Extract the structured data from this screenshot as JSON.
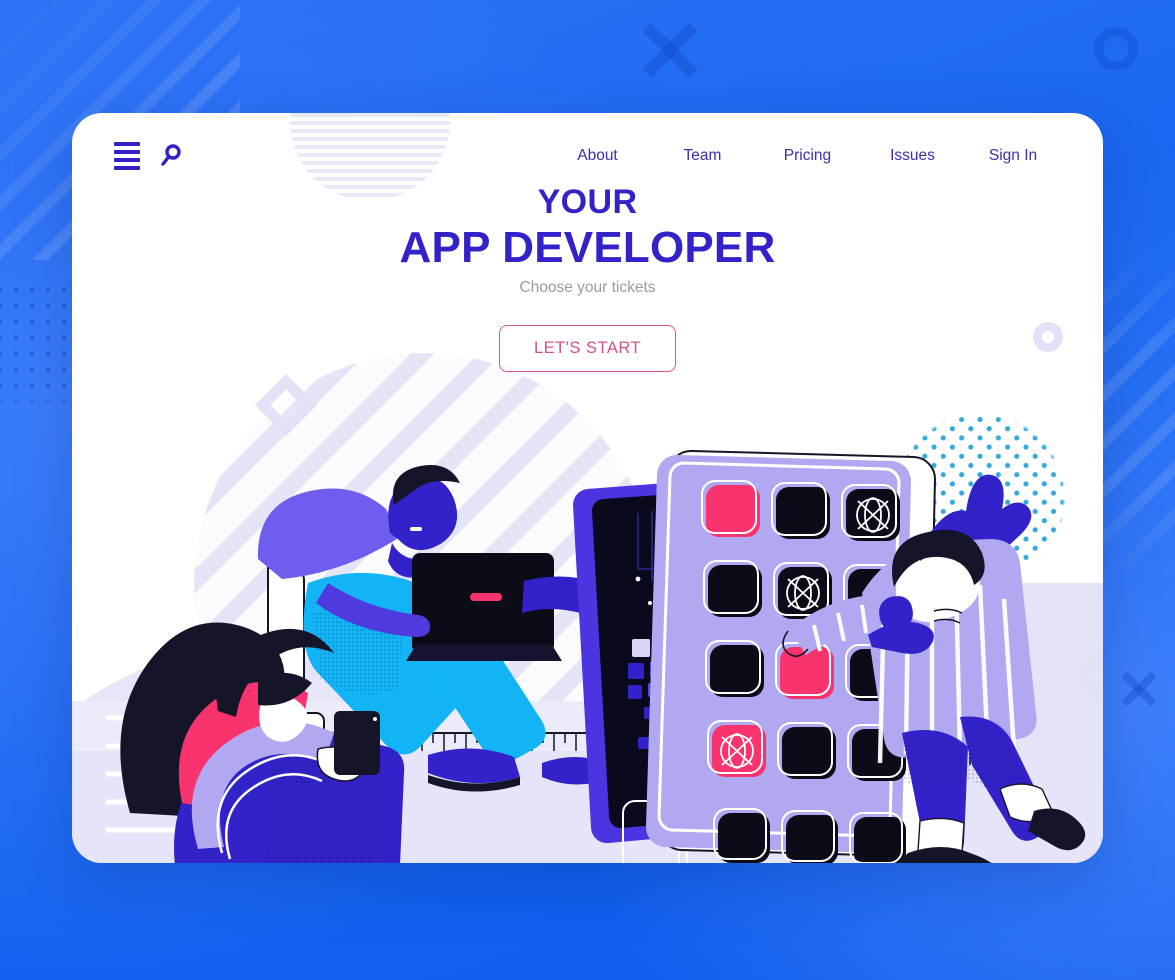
{
  "page": {
    "background_color": "#1464f0",
    "card_background": "#ffffff"
  },
  "header": {
    "menu_icon": "hamburger-icon",
    "search_icon": "search-icon",
    "nav": [
      {
        "label": "About"
      },
      {
        "label": "Team"
      },
      {
        "label": "Pricing"
      },
      {
        "label": "Issues"
      },
      {
        "label": "Sign In"
      }
    ]
  },
  "hero": {
    "eyebrow": "YOUR",
    "title": "APP DEVELOPER",
    "subtitle": "Choose your tickets",
    "cta_label": "LET'S START",
    "title_color": "#3322c9",
    "subtitle_color": "#9a9aa8",
    "cta_color": "#d8507f"
  },
  "illustration": {
    "name": "app-developer-illustration",
    "phone_back": {
      "name": "dark-circuit-phone",
      "screen_color": "#0a0a1e",
      "body_color": "#4a35e0"
    },
    "phone_front": {
      "name": "app-grid-phone",
      "body_color": "#b0a8f0",
      "app_tiles": [
        {
          "row": 1,
          "col": 1,
          "color": "#f9336e",
          "glyph": "none"
        },
        {
          "row": 1,
          "col": 2,
          "color": "#0c0c18",
          "glyph": "none"
        },
        {
          "row": 1,
          "col": 3,
          "color": "#0c0c18",
          "glyph": "target"
        },
        {
          "row": 2,
          "col": 1,
          "color": "#0c0c18",
          "glyph": "none"
        },
        {
          "row": 2,
          "col": 2,
          "color": "#0c0c18",
          "glyph": "target"
        },
        {
          "row": 2,
          "col": 3,
          "color": "#0c0c18",
          "glyph": "none"
        },
        {
          "row": 3,
          "col": 1,
          "color": "#0c0c18",
          "glyph": "none"
        },
        {
          "row": 3,
          "col": 2,
          "color": "#f9336e",
          "glyph": "none"
        },
        {
          "row": 3,
          "col": 3,
          "color": "#0c0c18",
          "glyph": "none"
        },
        {
          "row": 4,
          "col": 1,
          "color": "#f9336e",
          "glyph": "target"
        },
        {
          "row": 4,
          "col": 2,
          "color": "#0c0c18",
          "glyph": "none"
        },
        {
          "row": 4,
          "col": 3,
          "color": "#0c0c18",
          "glyph": "none"
        }
      ],
      "dock_tiles": 3
    },
    "characters": [
      {
        "name": "man-with-laptop",
        "shirt_color": "#6f5df0",
        "pants_color": "#12b4f5",
        "shoe_color": "#3322c9"
      },
      {
        "name": "woman-with-phone",
        "top_color": "#f9336e",
        "sleeve_color": "#b0a8f0",
        "pants_color": "#3322c9",
        "shoe_color": "#12b4f5"
      },
      {
        "name": "woman-waving-striped-dress",
        "dress_color": "#b0a8f0",
        "accent_color": "#3322c9",
        "shoe_color": "#111122"
      }
    ],
    "decor": [
      {
        "name": "dotted-diamond",
        "color": "#35a8dd"
      },
      {
        "name": "diamond-outline",
        "color": "#e2e2f6"
      },
      {
        "name": "donut-outline",
        "color": "#e2e2f6"
      },
      {
        "name": "ruler-line",
        "color": "#15152a"
      },
      {
        "name": "white-dot-grid",
        "color": "#ffffff"
      }
    ]
  },
  "background_decor": [
    {
      "name": "diagonal-stripes-top-left",
      "color": "rgba(255,255,255,0.13)"
    },
    {
      "name": "diagonal-stripes-right",
      "color": "rgba(255,255,255,0.12)"
    },
    {
      "name": "dot-grid-left",
      "color": "#0a3cb4"
    },
    {
      "name": "cross-icon-top",
      "color": "#0a40be"
    },
    {
      "name": "cross-icon-bottom-right",
      "color": "#0a40be"
    },
    {
      "name": "ring-icon-top-right",
      "color": "#0a40be"
    }
  ]
}
